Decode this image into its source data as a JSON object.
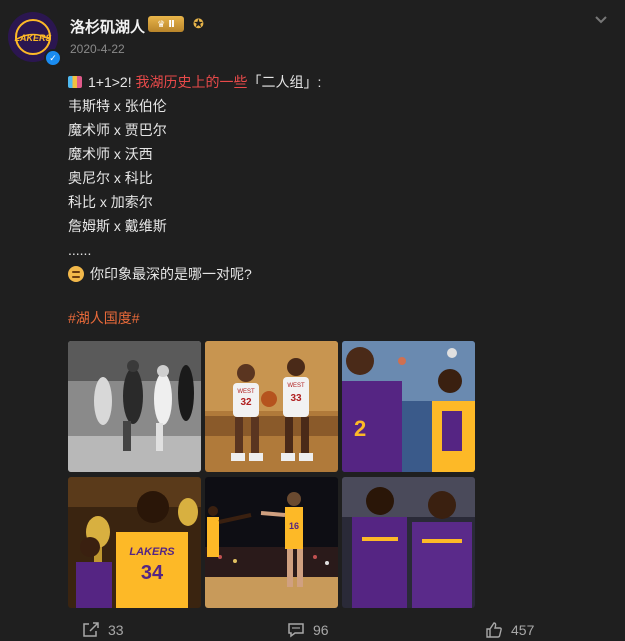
{
  "post": {
    "author": "洛杉矶湖人",
    "vip_level": "Ⅱ",
    "date": "2020-4-22",
    "lines": {
      "intro_a": "1+1>2! ",
      "intro_red": "我湖历史上的一些",
      "intro_b": "「二人组」:",
      "p1": "韦斯特 x 张伯伦",
      "p2": "魔术师 x 贾巴尔",
      "p3": "魔术师 x 沃西",
      "p4": "奥尼尔 x 科比",
      "p5": "科比 x 加索尔",
      "p6": "詹姆斯 x 戴维斯",
      "ellipsis": "......",
      "question": "你印象最深的是哪一对呢?"
    },
    "hashtag": "#湖人国度#",
    "photo_labels": {
      "p2_jersey_a": "WEST",
      "p2_jersey_b": "WEST",
      "p2_num_a": "32",
      "p2_num_b": "33",
      "p3_num": "2",
      "p4_team": "LAKERS",
      "p4_num": "34",
      "p5_num": "16"
    }
  },
  "actions": {
    "reposts": "33",
    "comments": "96",
    "likes": "457"
  },
  "colors": {
    "background": "#1f1f1f",
    "highlight": "#e84a4a",
    "hashtag": "#e96a3a",
    "lakers_purple": "#552583",
    "lakers_gold": "#fdb927"
  }
}
